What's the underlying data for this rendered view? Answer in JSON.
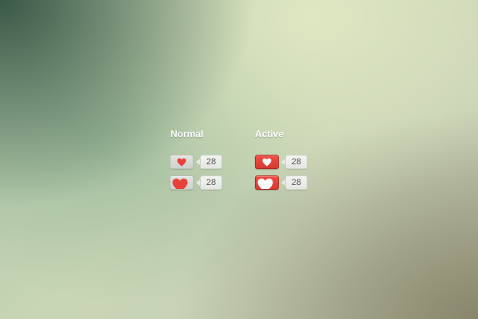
{
  "columns": {
    "normal_title": "Normal",
    "active_title": "Active"
  },
  "widgets": {
    "normal_small_count": "28",
    "normal_large_count": "28",
    "active_small_count": "28",
    "active_large_count": "28"
  },
  "colors": {
    "heart_red": "#e8413a",
    "heart_white": "#ffffff",
    "active_button": "#df3f36",
    "normal_button": "#d8d9d5"
  },
  "icons": {
    "heart": "heart-icon"
  }
}
